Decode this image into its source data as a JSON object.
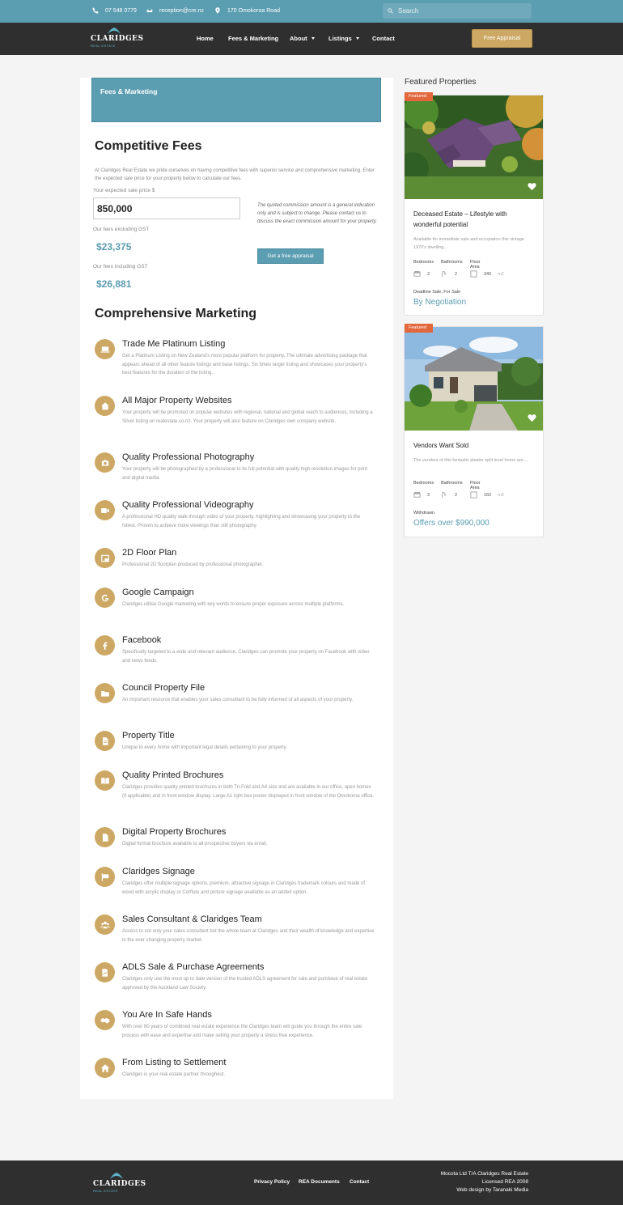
{
  "topbar": {
    "phone": "07 548 0779",
    "email": "reception@cre.nz",
    "address": "170 Omokoroa Road",
    "search_placeholder": "Search"
  },
  "brand": {
    "name": "CLARIDGES",
    "sub": "REAL ESTATE"
  },
  "nav": {
    "items": [
      "Home",
      "Fees & Marketing",
      "About",
      "Listings",
      "Contact"
    ],
    "cta": "Free Appraisal"
  },
  "main": {
    "banner": "Fees & Marketing",
    "fees_title": "Competitive Fees",
    "intro": "At Claridges Real Estate we pride ourselves on having competitive fees with superior service and comprehensive marketing. Enter the expected sale price for your property below to calculate our fees.",
    "price_label": "Your expected sale price $",
    "price_value": "850,000",
    "excl_label": "Our fees excluding GST",
    "excl_value": "$23,375",
    "incl_label": "Our fees including GST",
    "incl_value": "$26,881",
    "note": "The quoted commission amount is a general indication only and is subject to change. Please contact us to discuss the exact commission amount for your property.",
    "appraisal_btn": "Get a free appraisal",
    "marketing_title": "Comprehensive Marketing",
    "features": [
      {
        "icon": "laptop-icon",
        "title": "Trade Me Platinum Listing",
        "desc": "Get a Platinum Listing on New Zealand's most popular platform for property. The ultimate advertising package that appears ahead of all other feature listings and base listings. Six times larger listing and showcases your property's best features for the duration of the listing."
      },
      {
        "icon": "house-search-icon",
        "title": "All Major Property Websites",
        "desc": "Your property will be promoted on popular websites with regional, national and global reach to audiences, including a Silver listing on realestate.co.nz. Your property will also feature on Claridges own company website."
      },
      {
        "icon": "camera-icon",
        "title": "Quality Professional Photography",
        "desc": "Your property will be photographed by a professional to its full potential with quality high resolution images for print and digital media."
      },
      {
        "icon": "video-camera-icon",
        "title": "Quality Professional Videography",
        "desc": "A professional HD quality walk through video of your property, highlighting and showcasing your property to the fullest. Proven to achieve more viewings than still photography."
      },
      {
        "icon": "floor-plan-icon",
        "title": "2D Floor Plan",
        "desc": "Professional 2D floorplan produced by professional photographer."
      },
      {
        "icon": "google-icon",
        "title": "Google Campaign",
        "desc": "Claridges utilise Google marketing with key words to ensure proper exposure across multiple platforms."
      },
      {
        "icon": "facebook-icon",
        "title": "Facebook",
        "desc": "Specifically targeted to a wide and relevant audience, Claridges can promote your property on Facebook with video and news feeds."
      },
      {
        "icon": "folder-icon",
        "title": "Council Property File",
        "desc": "An important resource that enables your sales consultant to be fully informed of all aspects of your property."
      },
      {
        "icon": "document-icon",
        "title": "Property Title",
        "desc": "Unique to every home with important legal details pertaining to your property."
      },
      {
        "icon": "book-icon",
        "title": "Quality Printed Brochures",
        "desc": "Claridges provides quality printed brochures in both Tri-Fold and A4 size and are available in our office, open homes (if applicable) and in front window display. Large A1 light box poster displayed in front window of the Omokoroa office."
      },
      {
        "icon": "file-icon",
        "title": "Digital Property Brochures",
        "desc": "Digital format brochure available to all prospective buyers via email."
      },
      {
        "icon": "sign-icon",
        "title": "Claridges Signage",
        "desc": "Claridges offer multiple signage options, premium, attractive signage in Claridges trademark colours and made of wood with acrylic display or Corflute and picture signage available as an added option."
      },
      {
        "icon": "team-icon",
        "title": "Sales Consultant & Claridges Team",
        "desc": "Access to not only your sales consultant but the whole team at Claridges and their wealth of knowledge and expertise in the ever changing property market."
      },
      {
        "icon": "signature-icon",
        "title": "ADLS Sale & Purchase Agreements",
        "desc": "Claridges only use the most up to date version of the trusted ADLS agreement for sale and purchase of real estate approved by the Auckland Law Society."
      },
      {
        "icon": "handshake-icon",
        "title": "You Are In Safe Hands",
        "desc": "With over 80 years of combined real estate experience the Claridges team will guide you through the entire sale process with ease and expertise and make selling your property a stress free experience."
      },
      {
        "icon": "home-icon",
        "title": "From Listing to Settlement",
        "desc": "Claridges is your real estate partner throughout."
      }
    ]
  },
  "sidebar": {
    "title": "Featured Properties",
    "cards": [
      {
        "badge": "Featured",
        "title": "Deceased Estate – Lifestyle with wonderful potential",
        "desc": "Available  for immediate sale and occupation this vintage 1970's dwelling...",
        "bed_label": "Bedrooms",
        "bath_label": "Bathrooms",
        "area_label": "Floor Area",
        "beds": "3",
        "baths": "2",
        "area": "340",
        "area_unit": "m2",
        "sale_type": "Deadline Sale, For Sale",
        "price": "By Negotiation"
      },
      {
        "badge": "Featured",
        "title": "Vendors Want Sold",
        "desc": "The vendors of this fantastic plaster split level home are...",
        "bed_label": "Bedrooms",
        "bath_label": "Bathrooms",
        "area_label": "Floor Area",
        "beds": "3",
        "baths": "2",
        "area": "160",
        "area_unit": "m2",
        "sale_type": "Withdrawn",
        "price": "Offers over $990,000"
      }
    ]
  },
  "footer": {
    "links": [
      "Privacy Policy",
      "REA Documents",
      "Contact"
    ],
    "company": "Mocota Ltd T/A Claridges Real Estate",
    "license": "Licensed REA 2008",
    "credit": "Web design by Taranaki Media"
  },
  "colors": {
    "teal": "#5b9db1",
    "gold": "#cda864",
    "dark": "#2f2f2f",
    "badge": "#e2673d"
  }
}
